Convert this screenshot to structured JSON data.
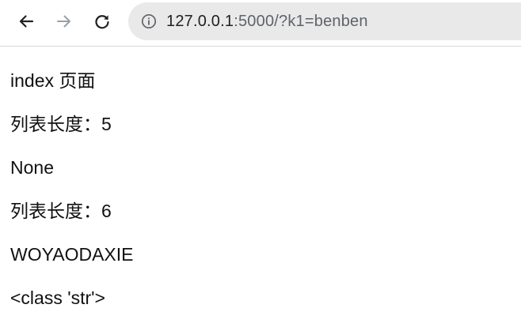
{
  "browser": {
    "url_host": "127.0.0.1",
    "url_rest": ":5000/?k1=benben",
    "icons": {
      "back": "arrow-left-icon",
      "forward": "arrow-right-icon",
      "reload": "reload-icon",
      "info": "info-icon"
    }
  },
  "page": {
    "lines": [
      "index 页面",
      "列表长度：5",
      "None",
      "列表长度：6",
      "WOYAODAXIE",
      "<class 'str'>"
    ]
  }
}
